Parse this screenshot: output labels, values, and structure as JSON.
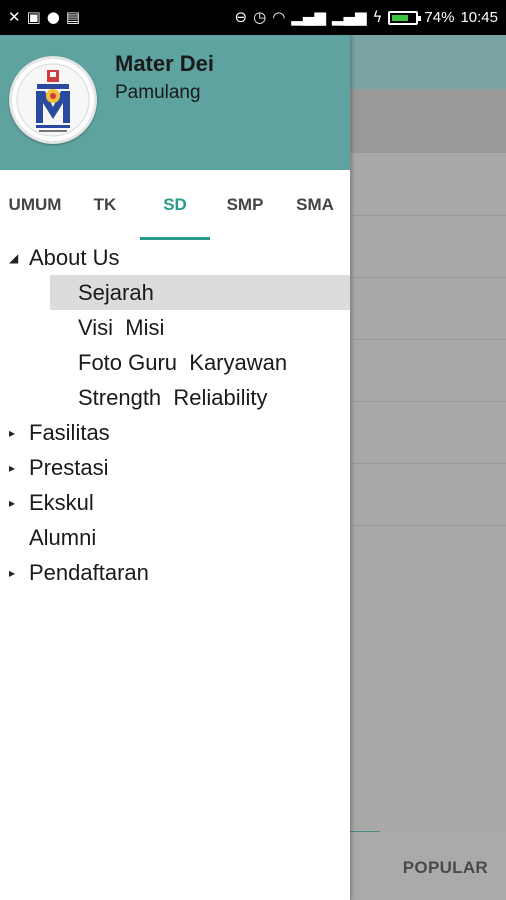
{
  "statusbar": {
    "left_icons": [
      "missed-call-icon",
      "image-icon",
      "circle-icon",
      "activity-icon"
    ],
    "battery_percent": "74%",
    "battery_level": 0.74,
    "time": "10:45"
  },
  "drawer": {
    "header": {
      "school_name": "Mater Dei",
      "location": "Pamulang"
    },
    "tabs": [
      {
        "label": "UMUM",
        "active": false
      },
      {
        "label": "TK",
        "active": false
      },
      {
        "label": "SD",
        "active": true
      },
      {
        "label": "SMP",
        "active": false
      },
      {
        "label": "SMA",
        "active": false
      }
    ],
    "tree": [
      {
        "label": "About Us",
        "expanded": true,
        "children": [
          {
            "label": "Sejarah",
            "selected": true
          },
          {
            "label": "Visi  Misi"
          },
          {
            "label": "Foto Guru  Karyawan"
          },
          {
            "label": "Strength  Reliability"
          }
        ]
      },
      {
        "label": "Fasilitas",
        "expanded": false
      },
      {
        "label": "Prestasi",
        "expanded": false
      },
      {
        "label": "Ekskul",
        "expanded": false
      },
      {
        "label": "Alumni",
        "leaf": true
      },
      {
        "label": "Pendaftaran",
        "expanded": false
      }
    ]
  },
  "background": {
    "bottom_tab_label": "POPULAR"
  },
  "colors": {
    "header_bg": "#5ea39f",
    "accent": "#2a9a8a"
  }
}
